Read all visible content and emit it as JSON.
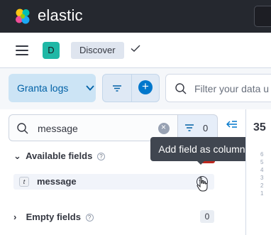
{
  "header": {
    "brand": "elastic"
  },
  "breadcrumb": {
    "space_initial": "D",
    "current": "Discover"
  },
  "toolbar": {
    "data_view": "Granta logs",
    "query_placeholder": "Filter your data u"
  },
  "sidebar": {
    "search_value": "message",
    "filter_count": "0",
    "available_label": "Available fields",
    "available_count": "1",
    "fields": [
      {
        "type": "t",
        "name": "message"
      }
    ],
    "empty_label": "Empty fields",
    "empty_count": "0"
  },
  "tooltip": {
    "text": "Add field as column"
  },
  "main": {
    "hits": "35",
    "tick_labels": [
      "6",
      "5",
      "4",
      "3",
      "2",
      "1"
    ]
  },
  "colors": {
    "header_bg": "#25282f",
    "accent": "#0077cc",
    "space_avatar": "#20b8a6"
  }
}
